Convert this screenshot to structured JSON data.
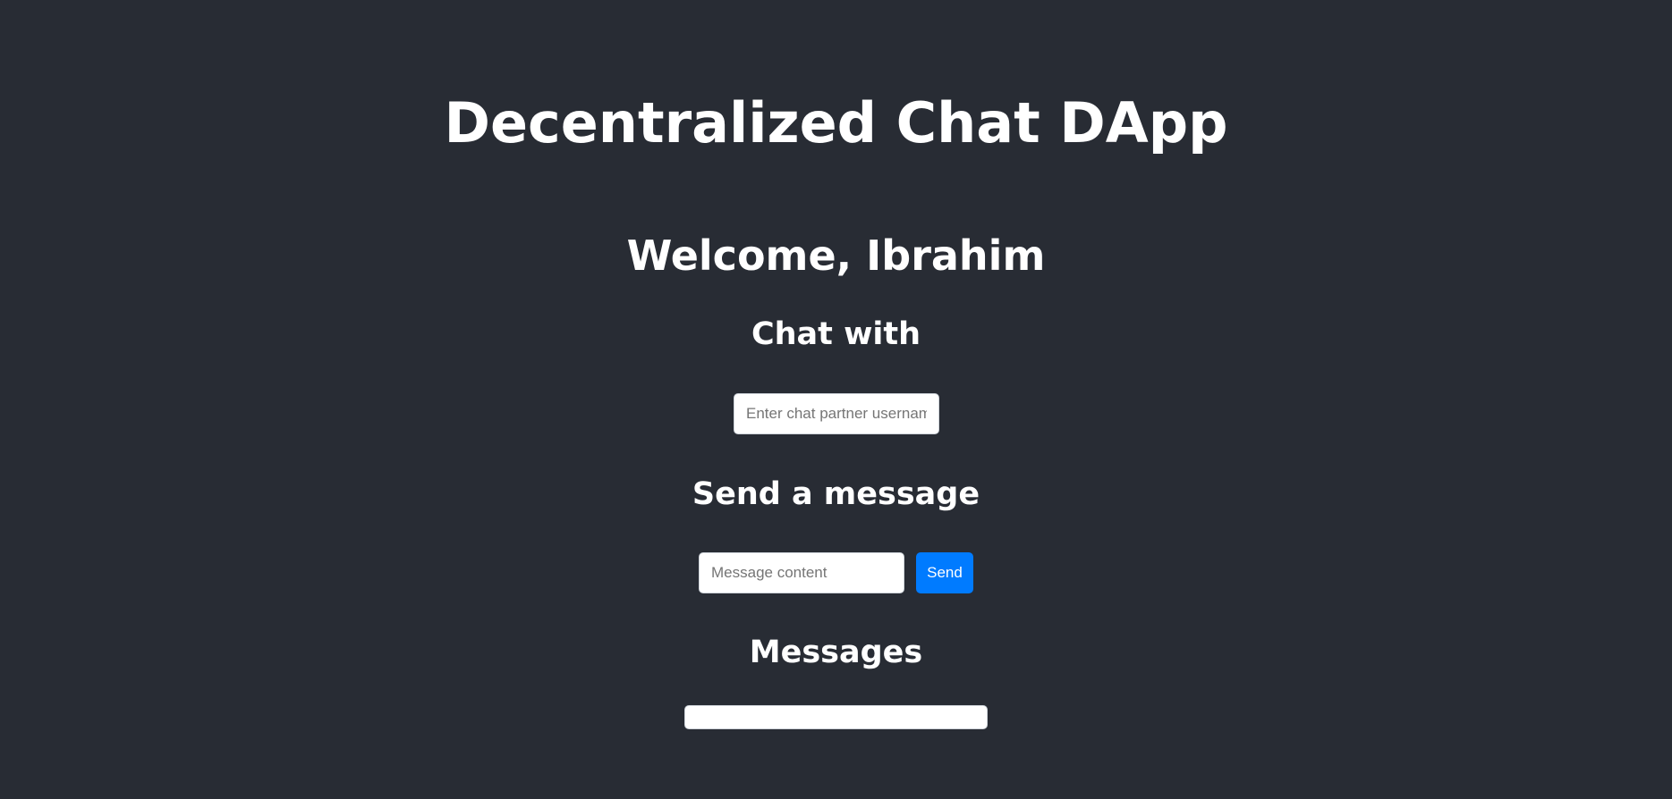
{
  "app": {
    "title": "Decentralized Chat DApp",
    "welcome": "Welcome, Ibrahim"
  },
  "chat_with": {
    "heading": "Chat with",
    "input_placeholder": "Enter chat partner username",
    "input_value": ""
  },
  "send_message": {
    "heading": "Send a message",
    "input_placeholder": "Message content",
    "input_value": "",
    "button_label": "Send"
  },
  "messages": {
    "heading": "Messages",
    "items": []
  },
  "colors": {
    "background": "#282c34",
    "accent": "#007bff",
    "text": "#ffffff"
  }
}
